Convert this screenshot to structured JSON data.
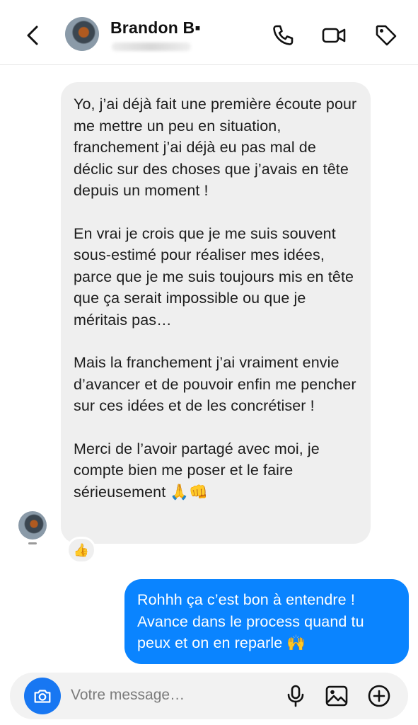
{
  "header": {
    "contact_name": "Brandon B▪",
    "icons": [
      "back-arrow-icon",
      "phone-icon",
      "video-camera-icon",
      "tag-icon"
    ]
  },
  "messages": {
    "incoming": {
      "paragraphs": [
        "Yo, j’ai déjà fait une première écoute pour me mettre un peu en situation, franchement j’ai déjà eu pas mal de déclic sur des choses que j’avais en tête depuis un moment !",
        "En vrai je crois que je me suis souvent sous-estimé pour réaliser mes idées, parce que je me suis toujours mis en tête que ça serait impossible ou que je méritais pas…",
        "Mais la franchement j’ai vraiment envie d’avancer et de pouvoir enfin me pencher sur ces idées et de les concrétiser !",
        "Merci de l’avoir partagé avec moi, je compte bien me poser et le faire sérieusement 🙏👊"
      ],
      "reaction": "👍"
    },
    "outgoing": {
      "text": "Rohhh ça c’est bon à entendre ! Avance dans le process quand tu peux et on en reparle 🙌"
    }
  },
  "composer": {
    "placeholder": "Votre message…",
    "icons": [
      "camera-icon",
      "microphone-icon",
      "image-icon",
      "add-icon"
    ]
  },
  "colors": {
    "outgoing_bubble": "#0a84ff",
    "incoming_bubble": "#efefef",
    "camera_button": "#1877f2"
  }
}
